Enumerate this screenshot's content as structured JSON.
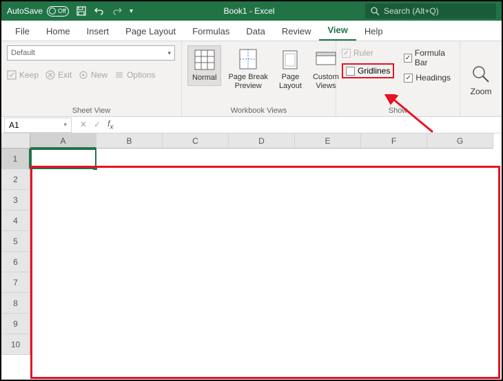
{
  "titlebar": {
    "autosave_label": "AutoSave",
    "autosave_state": "Off",
    "doc_title": "Book1  -  Excel",
    "search_placeholder": "Search (Alt+Q)"
  },
  "tabs": [
    "File",
    "Home",
    "Insert",
    "Page Layout",
    "Formulas",
    "Data",
    "Review",
    "View",
    "Help"
  ],
  "active_tab": "View",
  "ribbon": {
    "sheet_view": {
      "dropdown": "Default",
      "keep": "Keep",
      "exit": "Exit",
      "new": "New",
      "options": "Options",
      "group_label": "Sheet View"
    },
    "workbook_views": {
      "normal": "Normal",
      "page_break": "Page Break\nPreview",
      "page_layout": "Page\nLayout",
      "custom_views": "Custom\nViews",
      "group_label": "Workbook Views"
    },
    "show": {
      "ruler": "Ruler",
      "gridlines": "Gridlines",
      "formula_bar": "Formula Bar",
      "headings": "Headings",
      "group_label": "Show"
    },
    "zoom": {
      "zoom": "Zoom"
    }
  },
  "formula_bar": {
    "name_box": "A1"
  },
  "grid": {
    "columns": [
      "A",
      "B",
      "C",
      "D",
      "E",
      "F",
      "G"
    ],
    "rows": [
      "1",
      "2",
      "3",
      "4",
      "5",
      "6",
      "7",
      "8",
      "9",
      "10"
    ],
    "selected_col": "A",
    "selected_row": "1"
  }
}
